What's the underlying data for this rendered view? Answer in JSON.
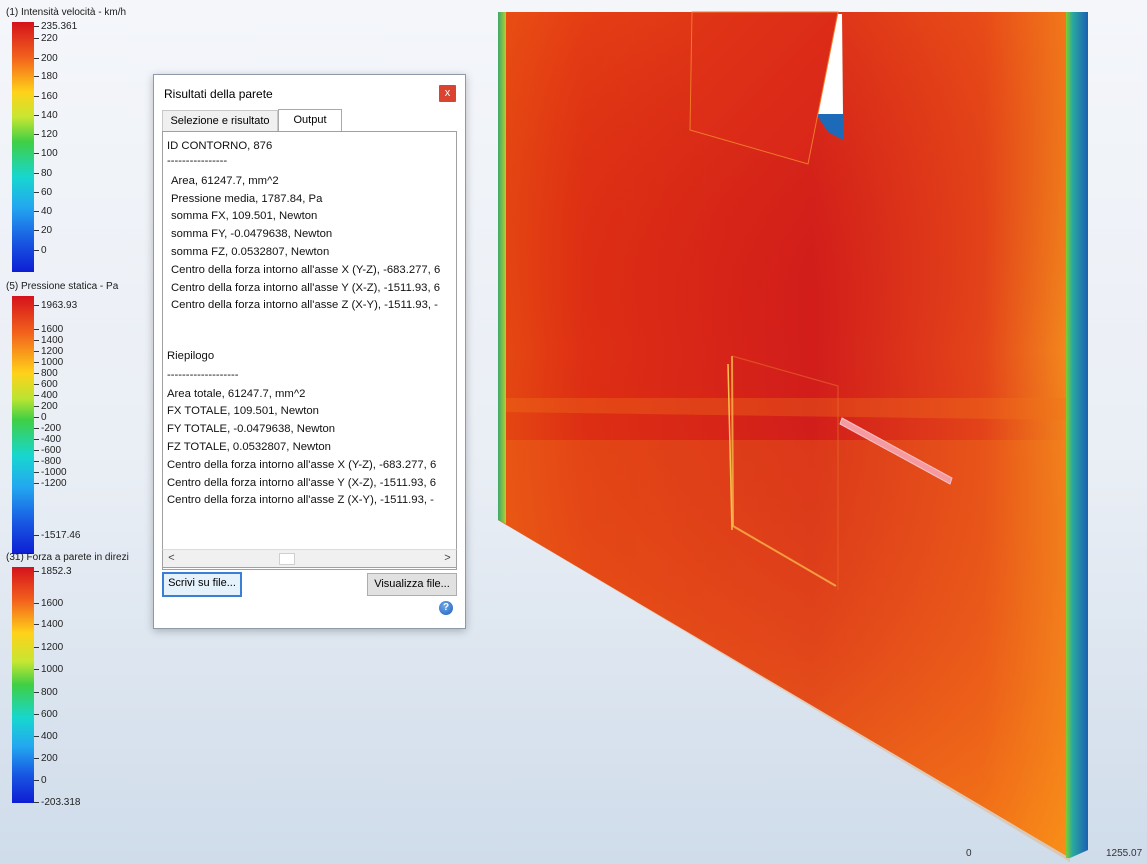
{
  "legends": [
    {
      "title": "(1) Intensità velocità - km/h",
      "ticks": [
        "235.361",
        "220",
        "200",
        "180",
        "160",
        "140",
        "120",
        "100",
        "80",
        "60",
        "40",
        "20",
        "0"
      ]
    },
    {
      "title": "(5) Pressione statica - Pa",
      "ticks": [
        "1963.93",
        "1600",
        "1400",
        "1200",
        "1000",
        "800",
        "600",
        "400",
        "200",
        "0",
        "-200",
        "-400",
        "-600",
        "-800",
        "-1000",
        "-1200",
        "-1517.46"
      ]
    },
    {
      "title": "(31) Forza a parete in direzi",
      "ticks": [
        "1852.3",
        "1600",
        "1400",
        "1200",
        "1000",
        "800",
        "600",
        "400",
        "200",
        "0",
        "-203.318"
      ]
    }
  ],
  "dialog": {
    "title": "Risultati della parete",
    "close_label": "x",
    "tabs": [
      "Selezione e risultato",
      "Output"
    ],
    "active_tab": "Output",
    "output_lines": [
      "ID CONTORNO, 876",
      "----------------",
      "Area, 61247.7, mm^2",
      "Pressione media, 1787.84, Pa",
      "somma FX, 109.501, Newton",
      "somma FY, -0.0479638, Newton",
      "somma FZ, 0.0532807, Newton",
      "Centro della forza intorno all'asse X (Y-Z), -683.277, 6",
      "Centro della forza intorno all'asse Y (X-Z), -1511.93, 6",
      "Centro della forza intorno all'asse Z (X-Y), -1511.93, -",
      "",
      "Riepilogo",
      "-------------------",
      "Area totale, 61247.7, mm^2",
      "FX TOTALE, 109.501, Newton",
      "FY TOTALE, -0.0479638, Newton",
      "FZ TOTALE, 0.0532807, Newton",
      "Centro della forza intorno all'asse X (Y-Z), -683.277, 6",
      "Centro della forza intorno all'asse Y (X-Z), -1511.93, 6",
      "Centro della forza intorno all'asse Z (X-Y), -1511.93, -"
    ],
    "scroll_left": "<",
    "scroll_right": ">",
    "write_button": "Scrivi su file...",
    "view_button": "Visualizza file...",
    "help_icon": "?"
  },
  "axis_labels": {
    "zero": "0",
    "end": "1255.07"
  },
  "colors": {
    "field_high": "#d21d1b",
    "field_mid": "#f0621a",
    "edge_blue": "#1a5fb4",
    "edge_green": "#7cc832"
  }
}
